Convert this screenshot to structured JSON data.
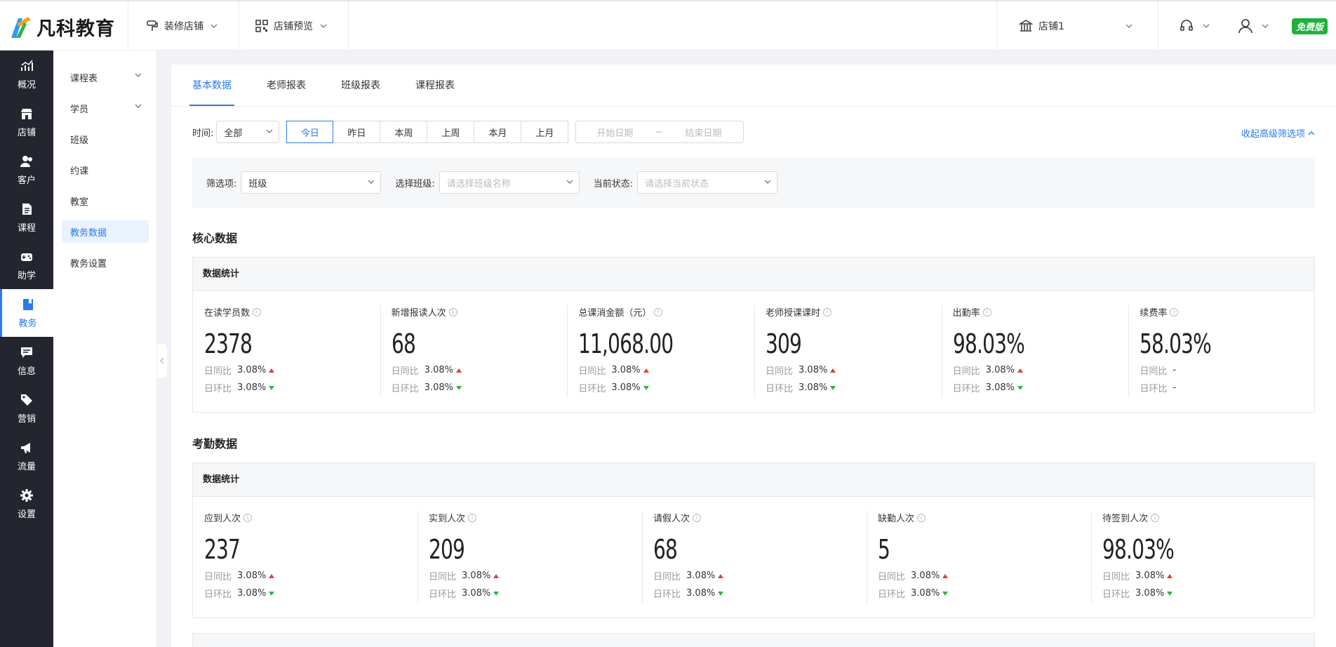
{
  "brand": {
    "name": "凡科教育",
    "badge": "免费版"
  },
  "topbar": {
    "decorate": "装修店铺",
    "preview": "店铺预览",
    "store": "店铺1"
  },
  "leftnav": [
    {
      "label": "概况",
      "icon": "chart-icon"
    },
    {
      "label": "店铺",
      "icon": "store-icon"
    },
    {
      "label": "客户",
      "icon": "users-icon"
    },
    {
      "label": "课程",
      "icon": "document-icon"
    },
    {
      "label": "助学",
      "icon": "gamepad-icon"
    },
    {
      "label": "教务",
      "icon": "book-icon",
      "active": true
    },
    {
      "label": "信息",
      "icon": "message-icon"
    },
    {
      "label": "营销",
      "icon": "tag-icon"
    },
    {
      "label": "流量",
      "icon": "megaphone-icon"
    },
    {
      "label": "设置",
      "icon": "gear-icon"
    }
  ],
  "subnav": [
    {
      "label": "课程表",
      "expandable": true
    },
    {
      "label": "学员",
      "expandable": true
    },
    {
      "label": "班级"
    },
    {
      "label": "约课"
    },
    {
      "label": "教室"
    },
    {
      "label": "教务数据",
      "active": true
    },
    {
      "label": "教务设置"
    }
  ],
  "tabs": [
    "基本数据",
    "老师报表",
    "班级报表",
    "课程报表"
  ],
  "filters": {
    "time_label": "时间:",
    "time_select": "全部",
    "ranges": [
      "今日",
      "昨日",
      "本周",
      "上周",
      "本月",
      "上月"
    ],
    "start_placeholder": "开始日期",
    "range_sep": "~",
    "end_placeholder": "结束日期",
    "advanced_toggle": "收起高级筛选项",
    "filter_label": "筛选项:",
    "filter_value": "班级",
    "class_label": "选择班级:",
    "class_placeholder": "请选择班级名称",
    "status_label": "当前状态:",
    "status_placeholder": "请选择当前状态"
  },
  "core": {
    "title": "核心数据",
    "box_title": "数据统计",
    "day_yoy": "日同比",
    "day_mom": "日环比",
    "items": [
      {
        "label": "在读学员数",
        "value": "2378",
        "yoy": "3.08%",
        "mom": "3.08%"
      },
      {
        "label": "新增报读人次",
        "value": "68",
        "yoy": "3.08%",
        "mom": "3.08%"
      },
      {
        "label": "总课消金额（元）",
        "value": "11,068.00",
        "yoy": "3.08%",
        "mom": "3.08%"
      },
      {
        "label": "老师授课课时",
        "value": "309",
        "yoy": "3.08%",
        "mom": "3.08%"
      },
      {
        "label": "出勤率",
        "value": "98.03%",
        "yoy": "3.08%",
        "mom": "3.08%"
      },
      {
        "label": "续费率",
        "value": "58.03%",
        "yoy": "-",
        "mom": "-"
      }
    ]
  },
  "attendance": {
    "title": "考勤数据",
    "box_title": "数据统计",
    "day_yoy": "日同比",
    "day_mom": "日环比",
    "items": [
      {
        "label": "应到人次",
        "value": "237",
        "yoy": "3.08%",
        "mom": "3.08%"
      },
      {
        "label": "实到人次",
        "value": "209",
        "yoy": "3.08%",
        "mom": "3.08%"
      },
      {
        "label": "请假人次",
        "value": "68",
        "yoy": "3.08%",
        "mom": "3.08%"
      },
      {
        "label": "缺勤人次",
        "value": "5",
        "yoy": "3.08%",
        "mom": "3.08%"
      },
      {
        "label": "待签到人次",
        "value": "98.03%",
        "yoy": "3.08%",
        "mom": "3.08%"
      }
    ]
  },
  "colors": {
    "accent": "#2b7bea",
    "nav_bg": "#23262e",
    "up": "#e23b3b",
    "down": "#2fb446",
    "badge": "#1db23a"
  }
}
